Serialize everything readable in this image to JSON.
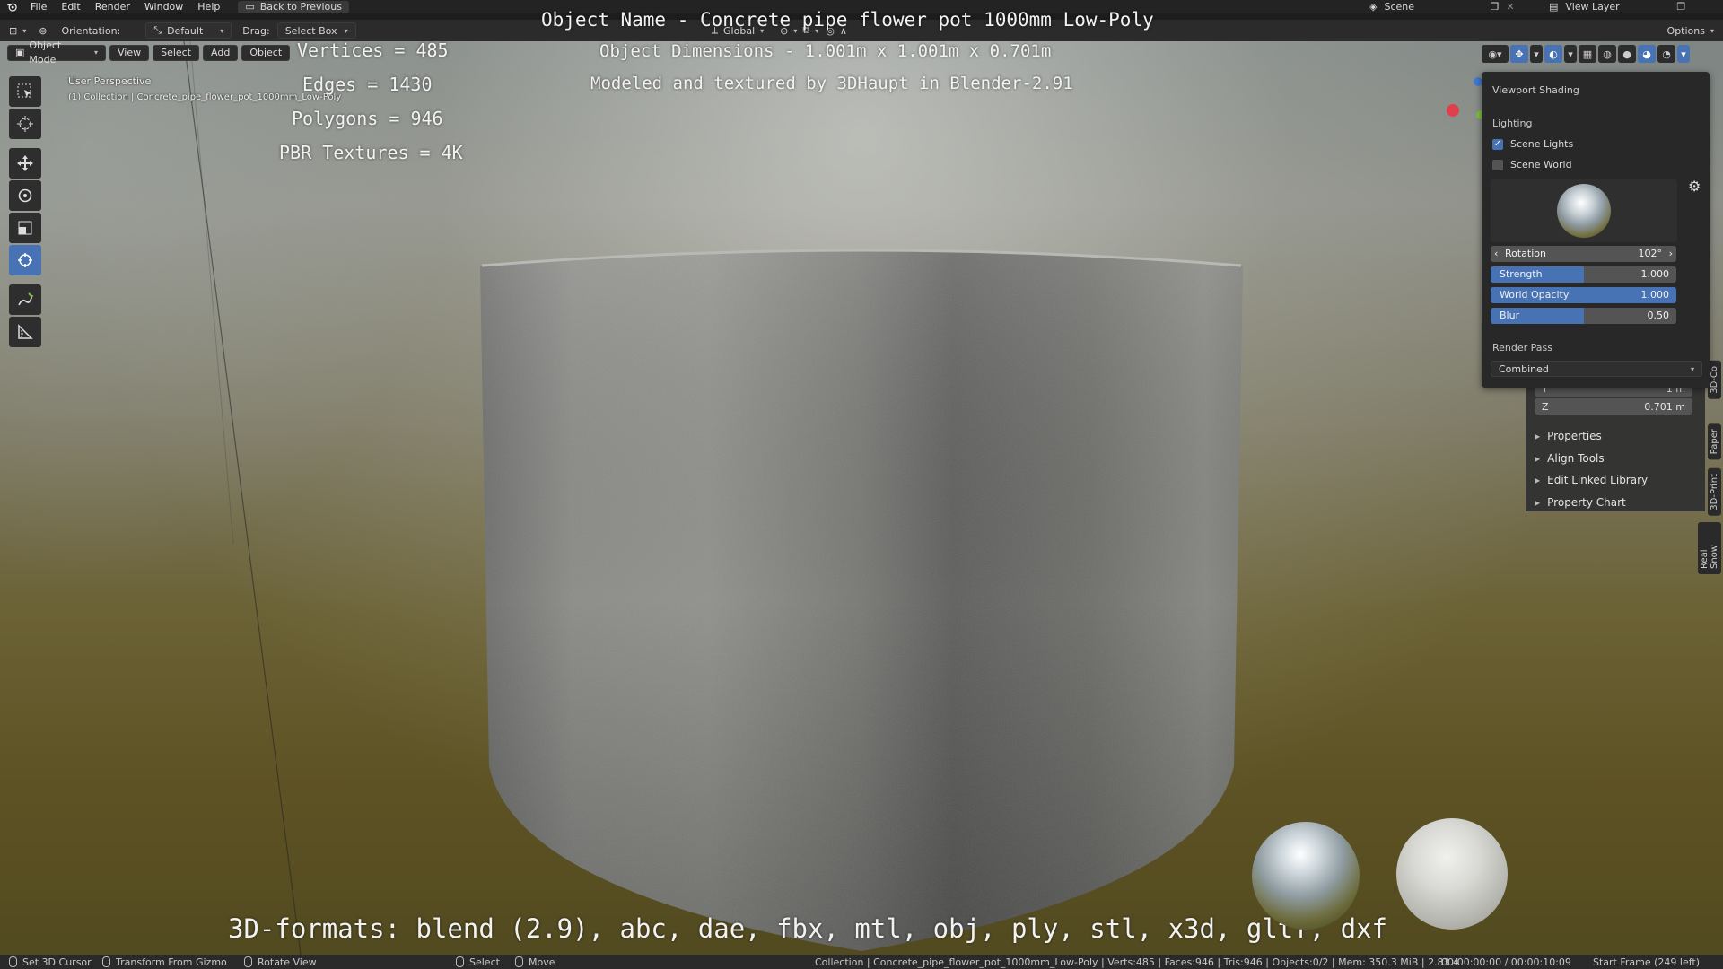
{
  "topbar": {
    "menu": [
      "File",
      "Edit",
      "Render",
      "Window",
      "Help"
    ],
    "back_button": "Back to Previous",
    "scene": "Scene",
    "view_layer": "View Layer"
  },
  "header": {
    "orientation_label": "Orientation:",
    "orientation_value": "Default",
    "drag_label": "Drag:",
    "drag_value": "Select Box",
    "transform_space": "Global",
    "options": "Options"
  },
  "modebar": {
    "mode": "Object Mode",
    "view": "View",
    "select": "Select",
    "add": "Add",
    "object": "Object"
  },
  "viewport_info": {
    "perspective": "User Perspective",
    "collection": "(1) Collection | Concrete_pipe_flower_pot_1000mm_Low-Poly"
  },
  "overlay": {
    "object_name": "Object Name - Concrete pipe flower pot 1000mm Low-Poly",
    "dimensions": "Object Dimensions -  1.001m x 1.001m x 0.701m",
    "modeled_by": "Modeled and textured by 3DHaupt in Blender-2.91",
    "vertices": "Vertices = 485",
    "edges": "Edges = 1430",
    "polygons": "Polygons = 946",
    "textures": "PBR Textures = 4K",
    "formats": "3D-formats: blend (2.9), abc, dae, fbx, mtl, obj, ply, stl, x3d, gltf, dxf"
  },
  "shading_panel": {
    "title": "Viewport Shading",
    "lighting_label": "Lighting",
    "scene_lights": "Scene Lights",
    "scene_lights_checked": true,
    "scene_world": "Scene World",
    "scene_world_checked": false,
    "rotation_label": "Rotation",
    "rotation_value": "102°",
    "strength_label": "Strength",
    "strength_value": "1.000",
    "strength_fill": 0.5,
    "world_opacity_label": "World Opacity",
    "world_opacity_value": "1.000",
    "world_opacity_fill": 1.0,
    "blur_label": "Blur",
    "blur_value": "0.50",
    "blur_fill": 0.5,
    "render_pass_label": "Render Pass",
    "render_pass_value": "Combined"
  },
  "npanel": {
    "y_label": "Y",
    "y_value": "1 m",
    "z_label": "Z",
    "z_value": "0.701 m",
    "sections": [
      "Properties",
      "Align Tools",
      "Edit Linked Library",
      "Property Chart"
    ]
  },
  "side_tabs": [
    "3D-Co",
    "Paper",
    "3D-Print",
    "Real Snow"
  ],
  "statusbar": {
    "set_cursor": "Set 3D Cursor",
    "transform_gizmo": "Transform From Gizmo",
    "rotate_view": "Rotate View",
    "select": "Select",
    "move": "Move",
    "stats": "Collection | Concrete_pipe_flower_pot_1000mm_Low-Poly | Verts:485 | Faces:946 | Tris:946 | Objects:0/2 | Mem: 350.3 MiB | 2.83.4",
    "timecode": "00:00:00:00 / 00:00:10:09",
    "frame": "Start Frame (249 left)"
  },
  "colors": {
    "accent": "#4772b3",
    "panel_bg": "#282828",
    "gizmo_x": "#e0404e",
    "gizmo_y": "#7ec23e",
    "gizmo_z": "#3f7ad2"
  }
}
